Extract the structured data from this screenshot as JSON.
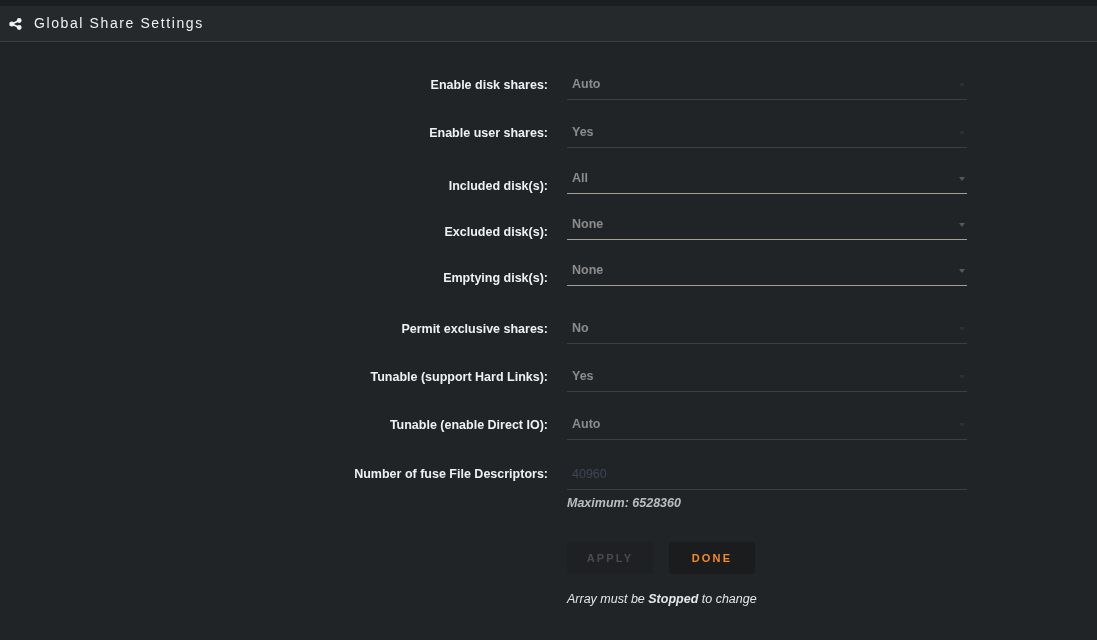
{
  "header": {
    "title": "Global Share Settings"
  },
  "sections": [
    {
      "rows": [
        {
          "label": "Enable disk shares:",
          "kind": "select",
          "value": "Auto",
          "disabled": true
        },
        {
          "label": "Enable user shares:",
          "kind": "select",
          "value": "Yes",
          "disabled": true
        },
        {
          "label": "Included disk(s):",
          "kind": "multiselect",
          "value": "All",
          "disabled": false
        },
        {
          "label": "Excluded disk(s):",
          "kind": "multiselect",
          "value": "None",
          "disabled": false
        },
        {
          "label": "Emptying disk(s):",
          "kind": "multiselect",
          "value": "None",
          "disabled": false
        }
      ]
    },
    {
      "rows": [
        {
          "label": "Permit exclusive shares:",
          "kind": "select",
          "value": "No",
          "disabled": true
        },
        {
          "label": "Tunable (support Hard Links):",
          "kind": "select",
          "value": "Yes",
          "disabled": true
        },
        {
          "label": "Tunable (enable Direct IO):",
          "kind": "select",
          "value": "Auto",
          "disabled": true
        },
        {
          "label": "Number of fuse File Descriptors:",
          "kind": "number",
          "placeholder": "40960",
          "disabled": true,
          "hint": "Maximum: 6528360"
        }
      ]
    }
  ],
  "buttons": [
    {
      "label": "APPLY",
      "disabled": true
    },
    {
      "label": "DONE",
      "disabled": false
    }
  ],
  "note": "Array must be **Stopped** to change"
}
